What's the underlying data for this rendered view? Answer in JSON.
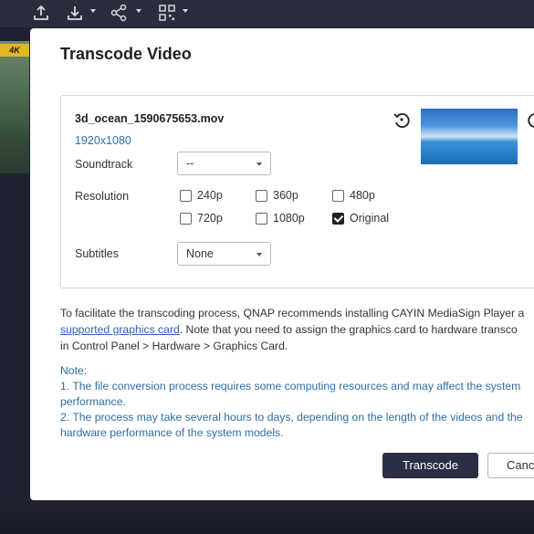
{
  "toolbar": {
    "icons": [
      "upload-icon",
      "download-icon",
      "share-icon",
      "qr-code-icon"
    ]
  },
  "background": {
    "badge": "4K"
  },
  "dialog": {
    "title": "Transcode Video",
    "file": {
      "name": "3d_ocean_1590675653.mov",
      "resolution": "1920x1080"
    },
    "soundtrack": {
      "label": "Soundtrack",
      "value": "--"
    },
    "resolution": {
      "label": "Resolution",
      "options": [
        {
          "label": "240p",
          "checked": false
        },
        {
          "label": "360p",
          "checked": false
        },
        {
          "label": "480p",
          "checked": false
        },
        {
          "label": "720p",
          "checked": false
        },
        {
          "label": "1080p",
          "checked": false
        },
        {
          "label": "Original",
          "checked": true
        }
      ]
    },
    "subtitles": {
      "label": "Subtitles",
      "value": "None"
    },
    "info": {
      "line1": "To facilitate the transcoding process, QNAP recommends installing CAYIN MediaSign Player a",
      "link": "supported graphics card",
      "line2_rest": ". Note that you need to assign the graphics card to hardware transco",
      "line3": "in Control Panel > Hardware > Graphics Card."
    },
    "note": {
      "heading": "Note:",
      "item1a": "1. The file conversion process requires some computing resources and may affect the system",
      "item1b": "performance.",
      "item2a": "2. The process may take several hours to days, depending on the length of the videos and the",
      "item2b": "hardware performance of the system models."
    },
    "buttons": {
      "primary": "Transcode",
      "secondary": "Canc"
    }
  }
}
